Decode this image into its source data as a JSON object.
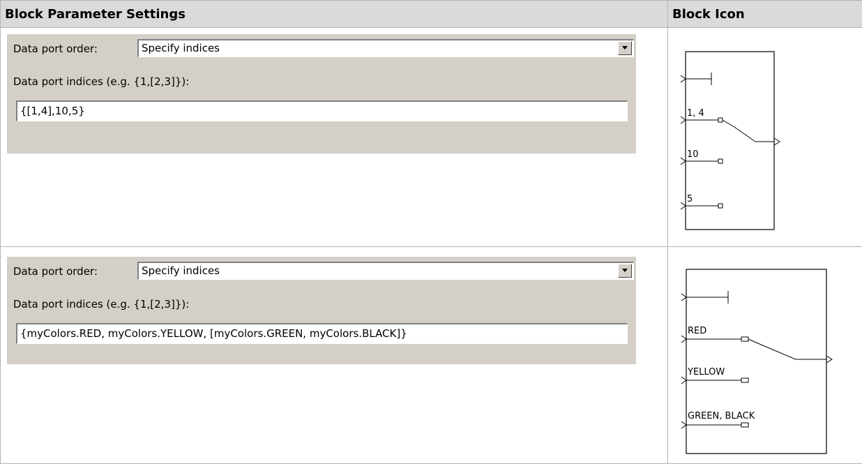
{
  "table": {
    "col_settings": "Block Parameter Settings",
    "col_icon": "Block Icon"
  },
  "rows": [
    {
      "order_label": "Data port order:",
      "order_value": "Specify indices",
      "indices_label": "Data port indices (e.g. {1,[2,3]}):",
      "indices_value": "{[1,4],10,5}",
      "ports": [
        "1, 4",
        "10",
        "5"
      ]
    },
    {
      "order_label": "Data port order:",
      "order_value": "Specify indices",
      "indices_label": "Data port indices (e.g. {1,[2,3]}):",
      "indices_value": "{myColors.RED, myColors.YELLOW, [myColors.GREEN, myColors.BLACK]}",
      "ports": [
        "RED",
        "YELLOW",
        "GREEN, BLACK"
      ]
    }
  ],
  "colors": {
    "header_bg": "#dadada",
    "dialog_bg": "#d4d0c8",
    "border": "#b3b3b3"
  },
  "icons": {
    "dropdown": "chevron-down-icon",
    "block": "multiport-switch-block-icon"
  }
}
